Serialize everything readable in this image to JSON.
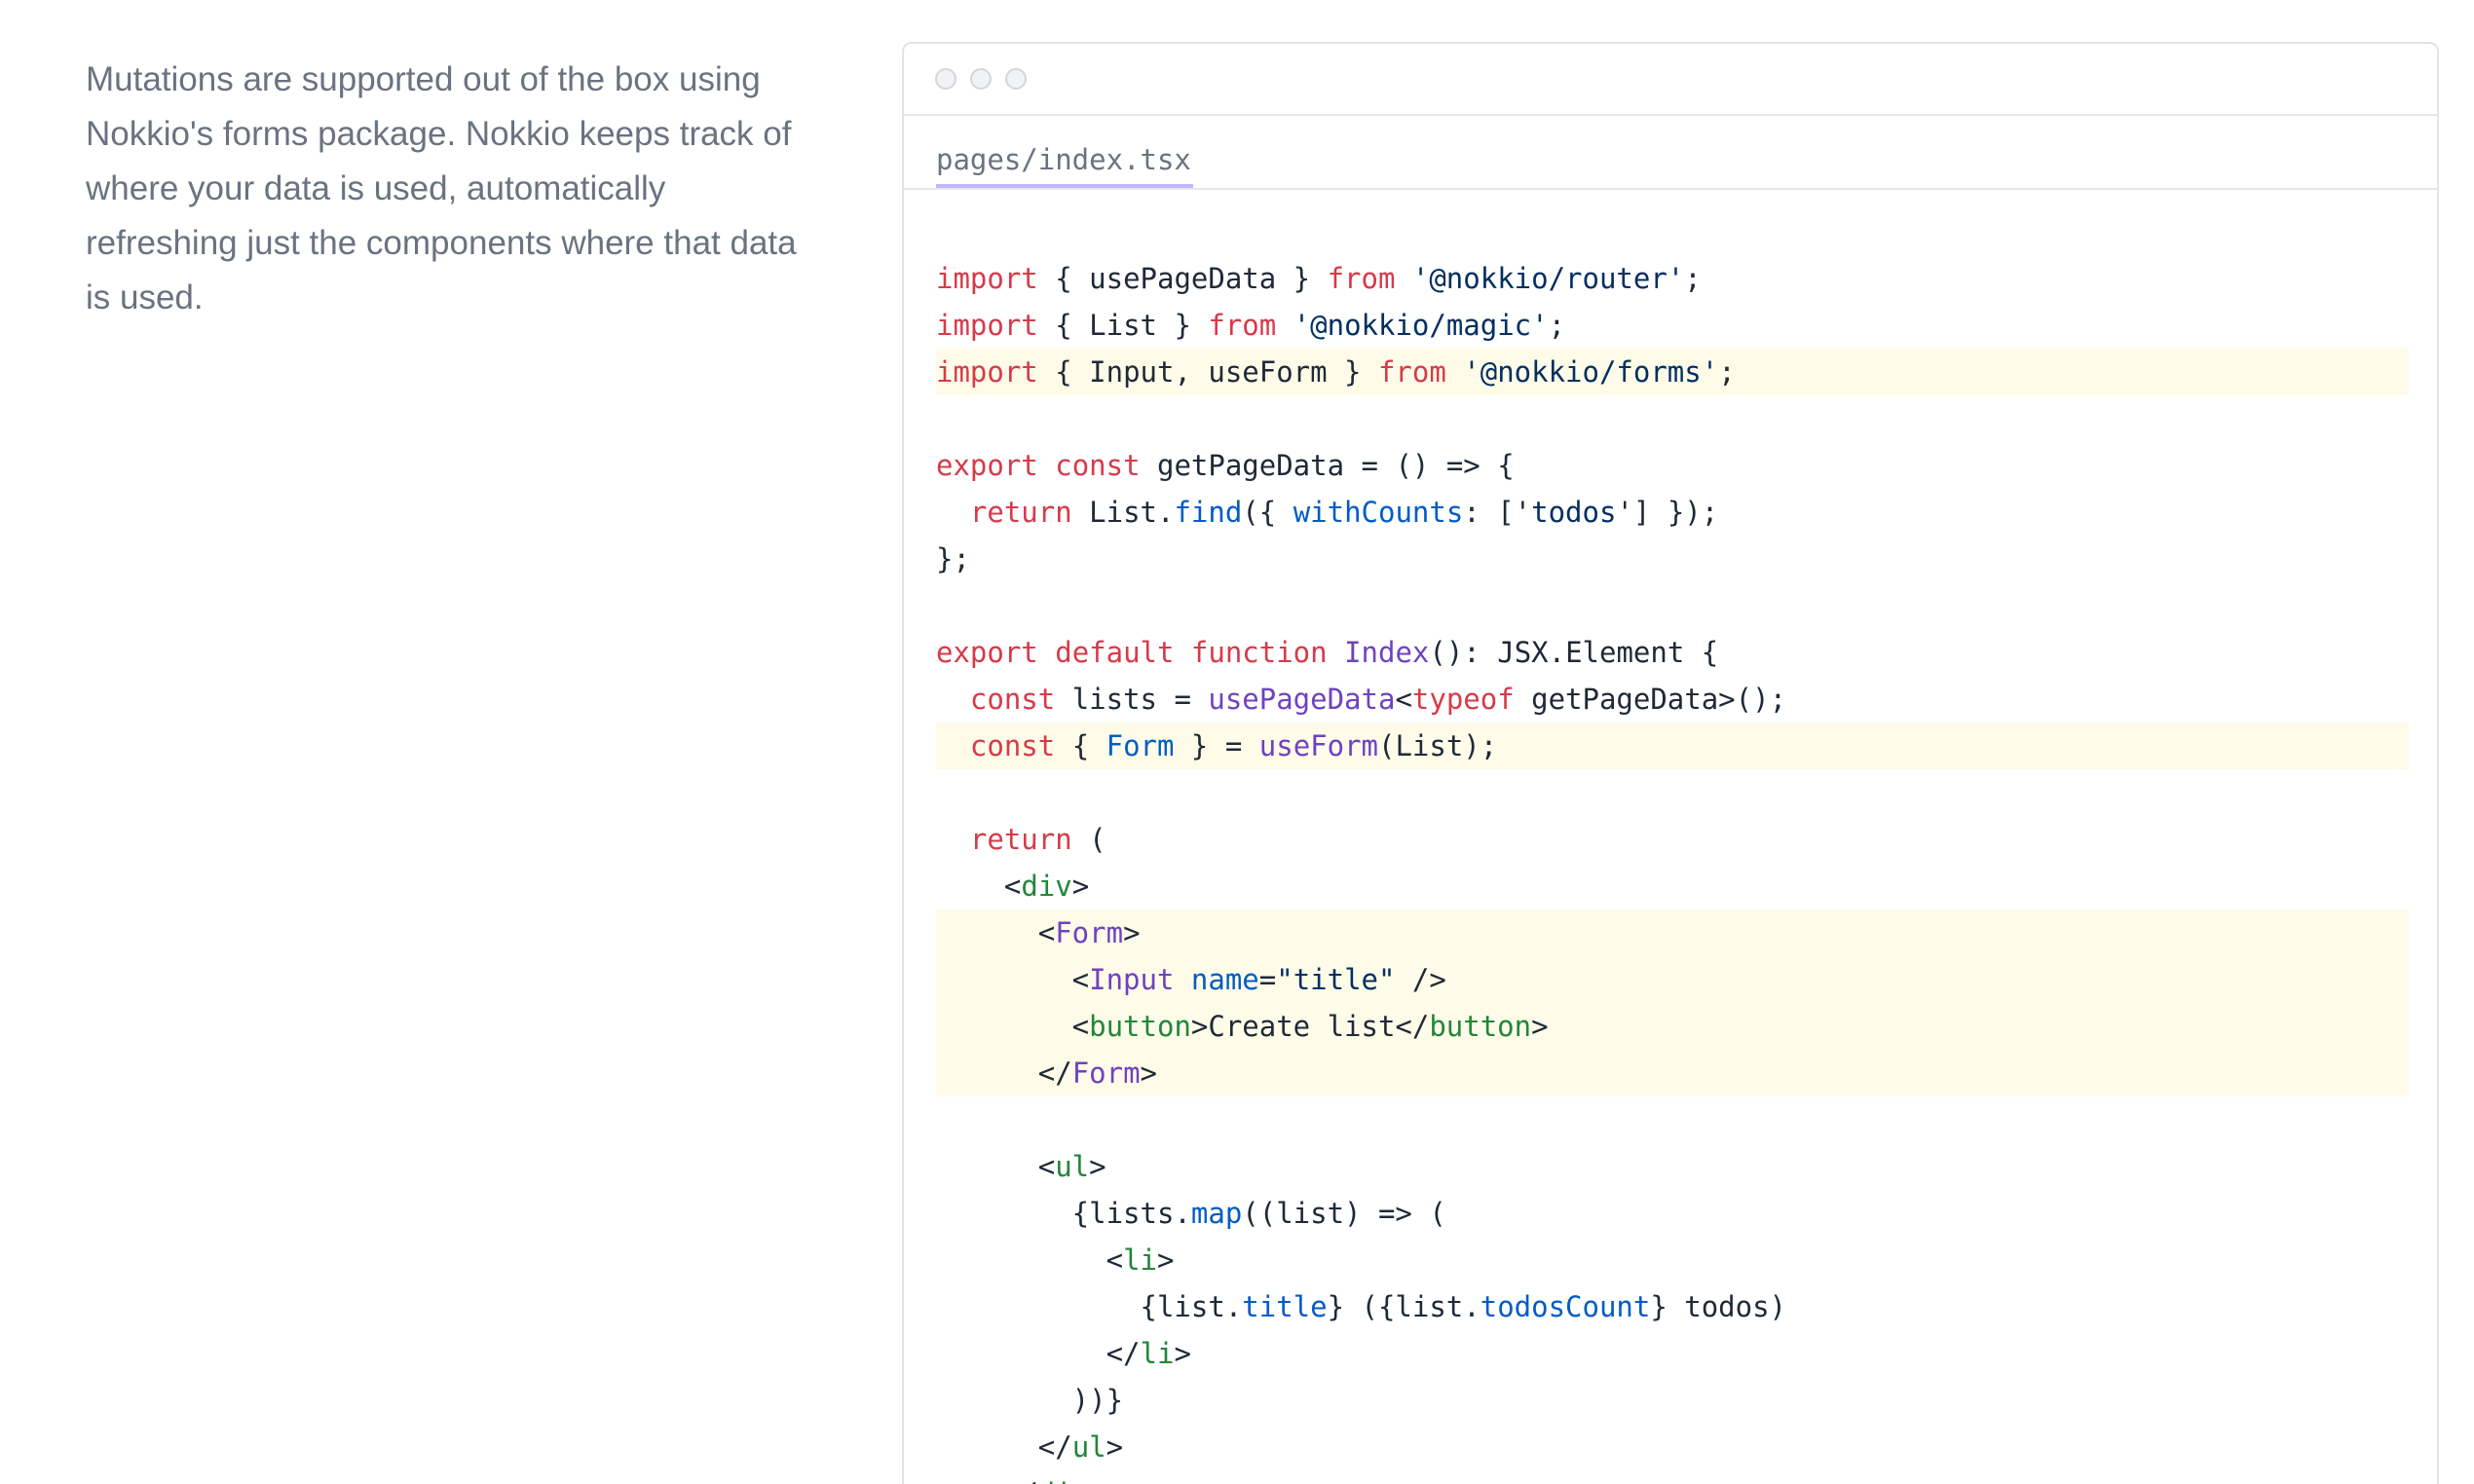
{
  "description": "Mutations are supported out of the box using Nokkio's forms package. Nokkio keeps track of where your data is used, automatically refreshing just the components where that data is used.",
  "editor": {
    "filename": "pages/index.tsx",
    "code_lines": [
      {
        "highlight": false,
        "tokens": [
          [
            "kw",
            "import"
          ],
          [
            "plain",
            " { usePageData } "
          ],
          [
            "kw",
            "from"
          ],
          [
            "plain",
            " "
          ],
          [
            "str",
            "'@nokkio/router'"
          ],
          [
            "plain",
            ";"
          ]
        ]
      },
      {
        "highlight": false,
        "tokens": [
          [
            "kw",
            "import"
          ],
          [
            "plain",
            " { List } "
          ],
          [
            "kw",
            "from"
          ],
          [
            "plain",
            " "
          ],
          [
            "str",
            "'@nokkio/magic'"
          ],
          [
            "plain",
            ";"
          ]
        ]
      },
      {
        "highlight": true,
        "tokens": [
          [
            "kw",
            "import"
          ],
          [
            "plain",
            " { Input, useForm } "
          ],
          [
            "kw",
            "from"
          ],
          [
            "plain",
            " "
          ],
          [
            "str",
            "'@nokkio/forms'"
          ],
          [
            "plain",
            ";"
          ]
        ]
      },
      {
        "highlight": false,
        "tokens": []
      },
      {
        "highlight": false,
        "tokens": [
          [
            "kw",
            "export"
          ],
          [
            "plain",
            " "
          ],
          [
            "kw",
            "const"
          ],
          [
            "plain",
            " getPageData = () => {"
          ]
        ]
      },
      {
        "highlight": false,
        "tokens": [
          [
            "plain",
            "  "
          ],
          [
            "kw",
            "return"
          ],
          [
            "plain",
            " List."
          ],
          [
            "prop",
            "find"
          ],
          [
            "plain",
            "({ "
          ],
          [
            "prop",
            "withCounts"
          ],
          [
            "plain",
            ": ['"
          ],
          [
            "str",
            "todos"
          ],
          [
            "plain",
            "'] });"
          ]
        ]
      },
      {
        "highlight": false,
        "tokens": [
          [
            "plain",
            "};"
          ]
        ]
      },
      {
        "highlight": false,
        "tokens": []
      },
      {
        "highlight": false,
        "tokens": [
          [
            "kw",
            "export"
          ],
          [
            "plain",
            " "
          ],
          [
            "kw",
            "default"
          ],
          [
            "plain",
            " "
          ],
          [
            "kw",
            "function"
          ],
          [
            "plain",
            " "
          ],
          [
            "fn",
            "Index"
          ],
          [
            "plain",
            "(): JSX.Element {"
          ]
        ]
      },
      {
        "highlight": false,
        "tokens": [
          [
            "plain",
            "  "
          ],
          [
            "kw",
            "const"
          ],
          [
            "plain",
            " lists = "
          ],
          [
            "fn",
            "usePageData"
          ],
          [
            "plain",
            "<"
          ],
          [
            "kw",
            "typeof"
          ],
          [
            "plain",
            " getPageData>();"
          ]
        ]
      },
      {
        "highlight": true,
        "tokens": [
          [
            "plain",
            "  "
          ],
          [
            "kw",
            "const"
          ],
          [
            "plain",
            " { "
          ],
          [
            "prop",
            "Form"
          ],
          [
            "plain",
            " } = "
          ],
          [
            "fn",
            "useForm"
          ],
          [
            "plain",
            "(List);"
          ]
        ]
      },
      {
        "highlight": false,
        "tokens": []
      },
      {
        "highlight": false,
        "tokens": [
          [
            "plain",
            "  "
          ],
          [
            "kw",
            "return"
          ],
          [
            "plain",
            " ("
          ]
        ]
      },
      {
        "highlight": false,
        "tokens": [
          [
            "plain",
            "    <"
          ],
          [
            "tag",
            "div"
          ],
          [
            "plain",
            ">"
          ]
        ]
      },
      {
        "highlight": true,
        "tokens": [
          [
            "plain",
            "      <"
          ],
          [
            "fn",
            "Form"
          ],
          [
            "plain",
            ">"
          ]
        ]
      },
      {
        "highlight": true,
        "tokens": [
          [
            "plain",
            "        <"
          ],
          [
            "fn",
            "Input"
          ],
          [
            "plain",
            " "
          ],
          [
            "prop",
            "name"
          ],
          [
            "plain",
            "="
          ],
          [
            "str",
            "\"title\""
          ],
          [
            "plain",
            " />"
          ]
        ]
      },
      {
        "highlight": true,
        "tokens": [
          [
            "plain",
            "        <"
          ],
          [
            "tag",
            "button"
          ],
          [
            "plain",
            ">Create list</"
          ],
          [
            "tag",
            "button"
          ],
          [
            "plain",
            ">"
          ]
        ]
      },
      {
        "highlight": true,
        "tokens": [
          [
            "plain",
            "      </"
          ],
          [
            "fn",
            "Form"
          ],
          [
            "plain",
            ">"
          ]
        ]
      },
      {
        "highlight": false,
        "tokens": []
      },
      {
        "highlight": false,
        "tokens": [
          [
            "plain",
            "      <"
          ],
          [
            "tag",
            "ul"
          ],
          [
            "plain",
            ">"
          ]
        ]
      },
      {
        "highlight": false,
        "tokens": [
          [
            "plain",
            "        {lists."
          ],
          [
            "prop",
            "map"
          ],
          [
            "plain",
            "((list) => ("
          ]
        ]
      },
      {
        "highlight": false,
        "tokens": [
          [
            "plain",
            "          <"
          ],
          [
            "tag",
            "li"
          ],
          [
            "plain",
            ">"
          ]
        ]
      },
      {
        "highlight": false,
        "tokens": [
          [
            "plain",
            "            {list."
          ],
          [
            "prop",
            "title"
          ],
          [
            "plain",
            "} ({list."
          ],
          [
            "prop",
            "todosCount"
          ],
          [
            "plain",
            "} todos)"
          ]
        ]
      },
      {
        "highlight": false,
        "tokens": [
          [
            "plain",
            "          </"
          ],
          [
            "tag",
            "li"
          ],
          [
            "plain",
            ">"
          ]
        ]
      },
      {
        "highlight": false,
        "tokens": [
          [
            "plain",
            "        ))}"
          ]
        ]
      },
      {
        "highlight": false,
        "tokens": [
          [
            "plain",
            "      </"
          ],
          [
            "tag",
            "ul"
          ],
          [
            "plain",
            ">"
          ]
        ]
      },
      {
        "highlight": false,
        "tokens": [
          [
            "plain",
            "    </"
          ],
          [
            "tag",
            "div"
          ],
          [
            "plain",
            ">"
          ]
        ]
      }
    ]
  }
}
